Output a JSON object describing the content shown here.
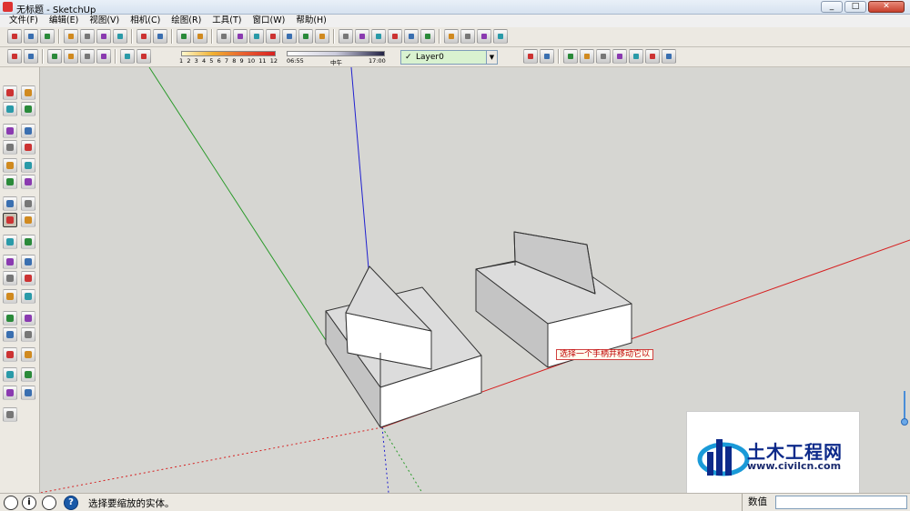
{
  "window": {
    "title": "无标题 - SketchUp"
  },
  "window_controls": {
    "minimize": "_",
    "maximize": "□",
    "close": "✕"
  },
  "menu": [
    {
      "label": "文件(F)"
    },
    {
      "label": "编辑(E)"
    },
    {
      "label": "视图(V)"
    },
    {
      "label": "相机(C)"
    },
    {
      "label": "绘图(R)"
    },
    {
      "label": "工具(T)"
    },
    {
      "label": "窗口(W)"
    },
    {
      "label": "帮助(H)"
    }
  ],
  "shadow_scale": {
    "ticks": [
      "1",
      "2",
      "3",
      "4",
      "5",
      "6",
      "7",
      "8",
      "9",
      "10",
      "11",
      "12"
    ]
  },
  "time_scale": {
    "start": "06:55",
    "middle": "中午",
    "end": "17:00"
  },
  "layer": {
    "name": "Layer0",
    "check": "✓",
    "arrow": "▼"
  },
  "tooltip": {
    "text": "选择一个手柄并移动它以"
  },
  "watermark": {
    "name": "土木工程网",
    "url": "www.civilcn.com"
  },
  "status": {
    "text": "选择要缩放的实体。",
    "measurements_label": "数值",
    "measurements_value": "",
    "info_icon": "i",
    "help_icon": "?"
  },
  "colors": {
    "axis_red": "#d62020",
    "axis_green": "#2a9a2a",
    "axis_blue": "#2020d0",
    "face_light": "#ffffff",
    "face_dark": "#c4c4c4",
    "face_mid": "#d8d8d8",
    "background": "#d6d6d2"
  },
  "icons": {
    "toolbar1": [
      "new-file-icon",
      "open-file-icon",
      "save-icon",
      "cut-icon",
      "copy-icon",
      "paste-icon",
      "erase-icon",
      "undo-icon",
      "redo-icon",
      "print-icon",
      "model-info-icon",
      "make-component-icon",
      "components-window-icon",
      "group-icon",
      "group-2-icon",
      "group-3-icon",
      "dimensions-icon",
      "text-icon",
      "add-location-icon",
      "toggle-terrain-icon",
      "get-models-icon",
      "share-model-icon",
      "iso-view-icon",
      "top-view-icon",
      "front-view-icon",
      "right-view-icon",
      "back-view-icon",
      "left-view-icon"
    ],
    "toolbar2": [
      "xray-icon",
      "wireframe-icon",
      "hidden-line-icon",
      "shaded-icon",
      "shaded-texture-icon",
      "monochrome-icon",
      "shadows-icon",
      "fog-icon",
      "section-plane-icon",
      "section-display-icon",
      "section-cuts-icon",
      "style-1-icon",
      "style-2-icon",
      "style-3-icon",
      "style-4-icon",
      "style-5-icon",
      "style-6-icon"
    ],
    "left": [
      "select-icon",
      "make-component-icon",
      "paint-bucket-icon",
      "eraser-icon",
      "rectangle-icon",
      "line-icon",
      "circle-icon",
      "arc-icon",
      "polygon-icon",
      "freehand-icon",
      "push-pull-icon",
      "follow-me-icon",
      "move-icon",
      "rotate-icon",
      "scale-icon",
      "offset-icon",
      "tape-measure-icon",
      "dimension-icon",
      "protractor-icon",
      "text-label-icon",
      "axes-icon",
      "3d-text-icon",
      "orbit-icon",
      "pan-icon",
      "zoom-icon",
      "zoom-window-icon",
      "zoom-extents-icon",
      "previous-view-icon",
      "position-camera-icon",
      "look-around-icon",
      "walk-icon",
      "section-plane-icon",
      "add-location-icon",
      "terrain-icon",
      "get-models-icon"
    ]
  }
}
